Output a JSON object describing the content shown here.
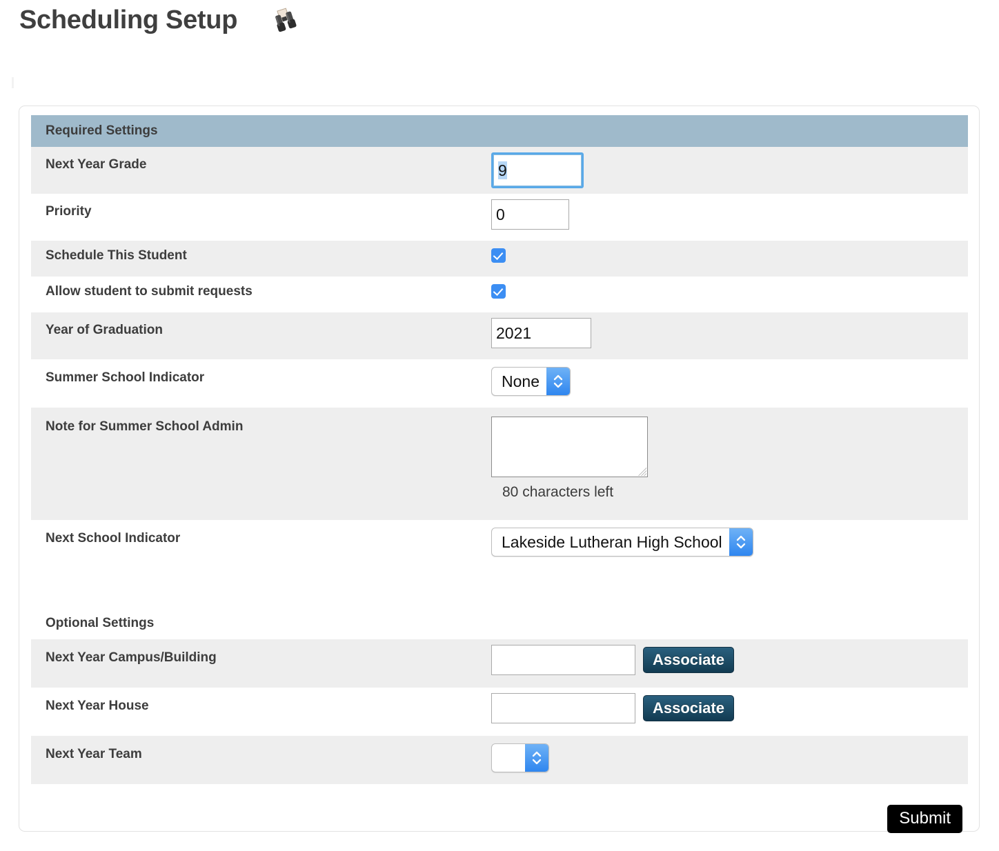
{
  "page": {
    "title": "Scheduling Setup",
    "title_icon": "binoculars-icon"
  },
  "colors": {
    "section_header_bg": "#9fbacb",
    "row_shaded_bg": "#eeeeee",
    "row_plain_bg": "#ffffff",
    "checkbox_accent": "#3c8ef3",
    "select_arrow_accent": "#2f86ef",
    "associate_button_bg": "#123b52",
    "submit_button_bg": "#000000",
    "focus_ring": "#5aa9e8",
    "selection_highlight": "#b5d6f5"
  },
  "required_section": {
    "heading": "Required Settings",
    "rows": [
      {
        "label": "Next Year Grade",
        "type": "text",
        "value": "9",
        "focused": true,
        "selected": true
      },
      {
        "label": "Priority",
        "type": "text",
        "value": "0"
      },
      {
        "label": "Schedule This Student",
        "type": "checkbox",
        "checked": true
      },
      {
        "label": "Allow student to submit requests",
        "type": "checkbox",
        "checked": true
      },
      {
        "label": "Year of Graduation",
        "type": "text",
        "value": "2021"
      },
      {
        "label": "Summer School Indicator",
        "type": "select",
        "value": "None"
      },
      {
        "label": "Note for Summer School Admin",
        "type": "textarea",
        "value": "",
        "helper": "80 characters left"
      },
      {
        "label": "Next School Indicator",
        "type": "select",
        "value": "Lakeside Lutheran High School"
      }
    ]
  },
  "optional_section": {
    "heading": "Optional Settings",
    "rows": [
      {
        "label": "Next Year Campus/Building",
        "type": "text_with_button",
        "value": "",
        "button_label": "Associate"
      },
      {
        "label": "Next Year House",
        "type": "text_with_button",
        "value": "",
        "button_label": "Associate"
      },
      {
        "label": "Next Year Team",
        "type": "select",
        "value": ""
      }
    ]
  },
  "footer": {
    "submit_label": "Submit"
  }
}
